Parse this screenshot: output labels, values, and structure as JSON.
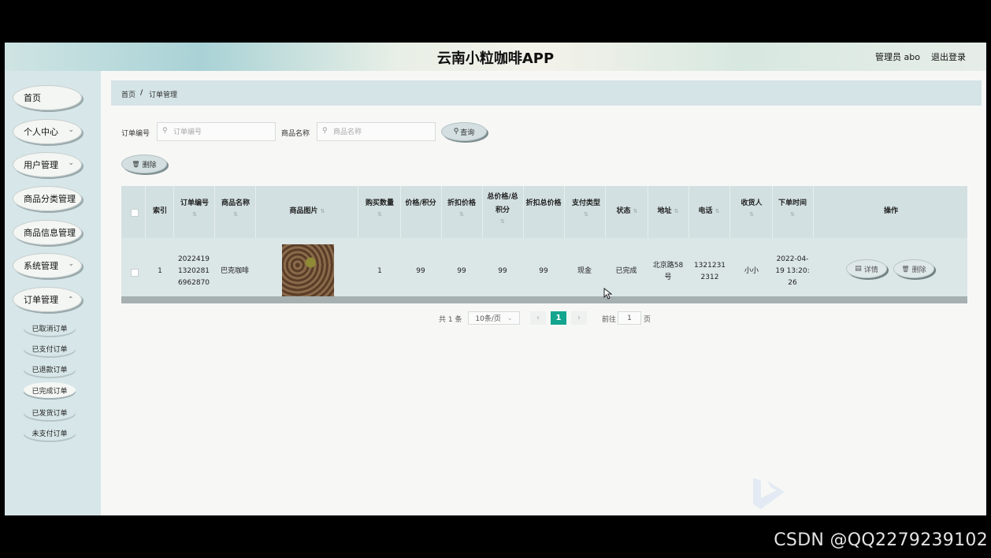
{
  "header": {
    "title": "云南小粒咖啡APP",
    "user": "管理员 abo",
    "logout": "退出登录"
  },
  "sidebar": {
    "items": [
      {
        "label": "首页",
        "has_chevron": false
      },
      {
        "label": "个人中心",
        "has_chevron": true
      },
      {
        "label": "用户管理",
        "has_chevron": true
      },
      {
        "label": "商品分类管理",
        "has_chevron": false
      },
      {
        "label": "商品信息管理",
        "has_chevron": false
      },
      {
        "label": "系统管理",
        "has_chevron": true
      },
      {
        "label": "订单管理",
        "has_chevron": true
      }
    ],
    "sub_items": [
      {
        "label": "已取消订单",
        "active": false
      },
      {
        "label": "已支付订单",
        "active": false
      },
      {
        "label": "已退款订单",
        "active": false
      },
      {
        "label": "已完成订单",
        "active": true
      },
      {
        "label": "已发货订单",
        "active": false
      },
      {
        "label": "未支付订单",
        "active": false
      }
    ],
    "chevron_glyph": "⌄"
  },
  "breadcrumb": {
    "home": "首页",
    "sep": "/",
    "current": "订单管理"
  },
  "search": {
    "order_no_label": "订单编号",
    "order_no_placeholder": "订单编号",
    "order_no_value": "",
    "product_label": "商品名称",
    "product_placeholder": "商品名称",
    "product_value": "",
    "search_button": "查询",
    "search_icon": "search-icon"
  },
  "actions": {
    "delete_button": "删除",
    "delete_icon": "trash-icon"
  },
  "table": {
    "headers": [
      "索引",
      "订单编号",
      "商品名称",
      "商品图片",
      "购买数量",
      "价格/积分",
      "折扣价格",
      "总价格/总积分",
      "折扣总价格",
      "支付类型",
      "状态",
      "地址",
      "电话",
      "收货人",
      "下单时间",
      "操作"
    ],
    "row": {
      "index": "1",
      "order_no": "20224191320281 6962870",
      "product_name": "巴克咖啡",
      "quantity": "1",
      "price": "99",
      "discount_price": "99",
      "total_price": "99",
      "discount_total": "99",
      "pay_type": "现金",
      "status": "已完成",
      "address": "北京路58号",
      "phone": "13212312312",
      "receiver": "小小",
      "order_time": "2022-04-19 13:20:26",
      "detail_button": "详情",
      "delete_button": "删除"
    }
  },
  "pagination": {
    "total": "共 1 条",
    "page_size": "10条/页",
    "current_page": "1",
    "goto_label": "前往",
    "goto_value": "1",
    "page_unit": "页"
  },
  "watermark": "CSDN @QQ2279239102",
  "colors": {
    "accent": "#13a58e",
    "sidebar": "#d7e6e8",
    "breadcrumb": "#d5e4e6"
  }
}
